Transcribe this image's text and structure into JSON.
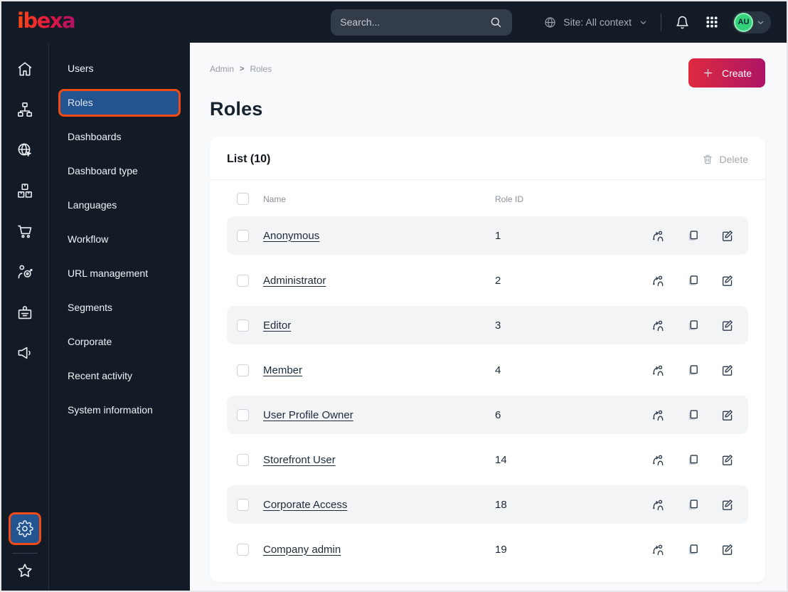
{
  "topbar": {
    "logo": "ibexa",
    "search_placeholder": "Search...",
    "search_icon": "search-icon",
    "site_context": "Site: All context",
    "site_icon": "globe-icon",
    "notification_icon": "bell-icon",
    "apps_icon": "apps-grid-icon",
    "avatar_initials": "AU"
  },
  "icon_sidebar": {
    "main": [
      "home",
      "content-structure",
      "site",
      "product-catalog",
      "commerce",
      "personalization",
      "corporate",
      "campaign"
    ],
    "bottom": [
      {
        "name": "admin-gear",
        "highlighted": true
      },
      {
        "name": "bookmarks-star",
        "highlighted": false
      }
    ]
  },
  "menu": {
    "items": [
      {
        "label": "Users",
        "selected": false
      },
      {
        "label": "Roles",
        "selected": true
      },
      {
        "label": "Dashboards",
        "selected": false
      },
      {
        "label": "Dashboard type",
        "selected": false
      },
      {
        "label": "Languages",
        "selected": false
      },
      {
        "label": "Workflow",
        "selected": false
      },
      {
        "label": "URL management",
        "selected": false
      },
      {
        "label": "Segments",
        "selected": false
      },
      {
        "label": "Corporate",
        "selected": false
      },
      {
        "label": "Recent activity",
        "selected": false
      },
      {
        "label": "System information",
        "selected": false
      }
    ]
  },
  "breadcrumb": {
    "items": [
      "Admin",
      "Roles"
    ],
    "separator": ">"
  },
  "page": {
    "title": "Roles",
    "create_label": "Create",
    "create_icon": "plus-icon"
  },
  "list": {
    "title": "List (10)",
    "delete_label": "Delete",
    "delete_icon": "trash-icon",
    "columns": [
      "Name",
      "Role ID"
    ],
    "row_action_icons": [
      "assign-user",
      "copy",
      "edit"
    ],
    "rows": [
      {
        "name": "Anonymous",
        "role_id": "1"
      },
      {
        "name": "Administrator",
        "role_id": "2"
      },
      {
        "name": "Editor",
        "role_id": "3"
      },
      {
        "name": "Member",
        "role_id": "4"
      },
      {
        "name": "User Profile Owner",
        "role_id": "6"
      },
      {
        "name": "Storefront User",
        "role_id": "14"
      },
      {
        "name": "Corporate Access",
        "role_id": "18"
      },
      {
        "name": "Company admin",
        "role_id": "19"
      }
    ]
  },
  "colors": {
    "topbar_bg": "#131c26",
    "accent_orange": "#f04a17",
    "selected_blue": "#24548f",
    "create_start": "#dd2a3f",
    "create_end": "#ae1566",
    "avatar_green": "#35d27c"
  }
}
